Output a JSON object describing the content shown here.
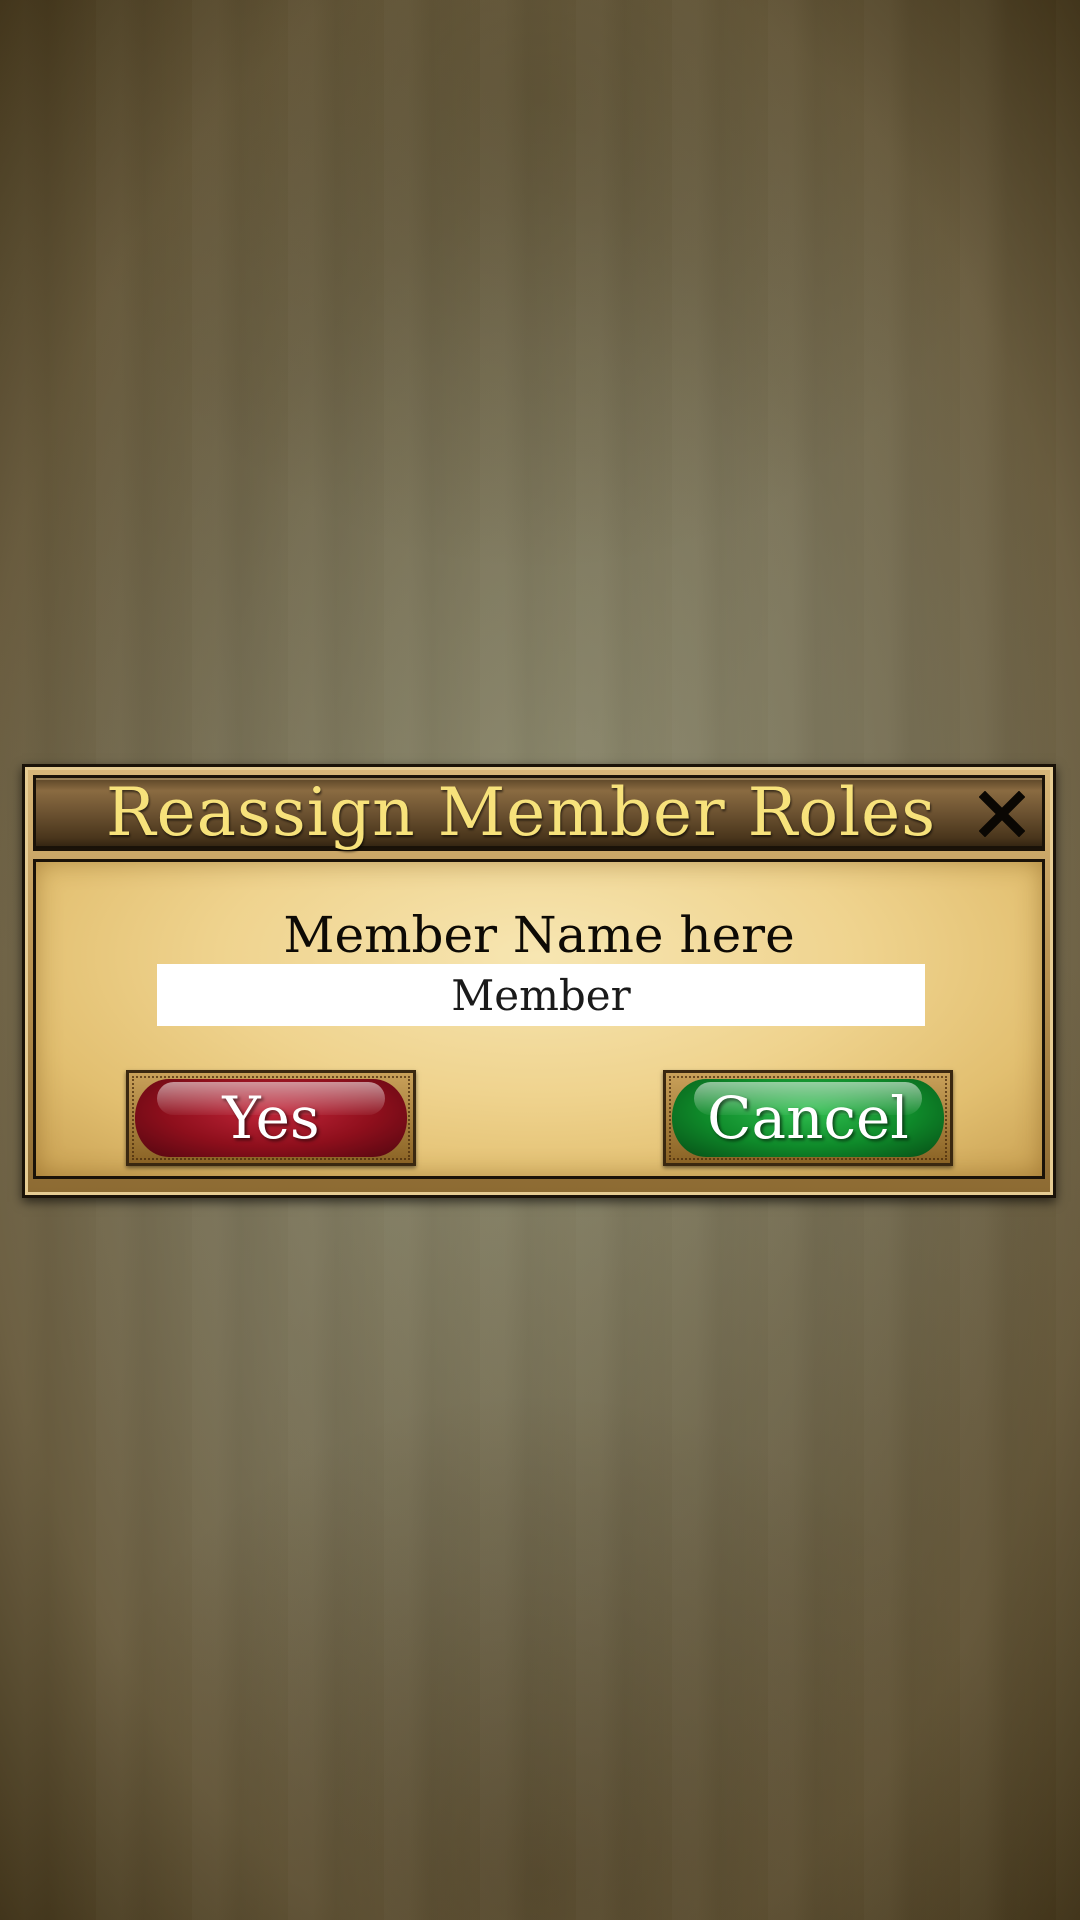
{
  "dialog": {
    "title": "Reassign Member Roles",
    "close_icon": "close-icon",
    "member_name": "Member Name here",
    "role_value": "Member",
    "yes_label": "Yes",
    "cancel_label": "Cancel"
  },
  "colors": {
    "title_text": "#f7e27b",
    "yes_button": "#8e0f1c",
    "cancel_button": "#0f8a2a",
    "parchment": "#efd38e"
  }
}
